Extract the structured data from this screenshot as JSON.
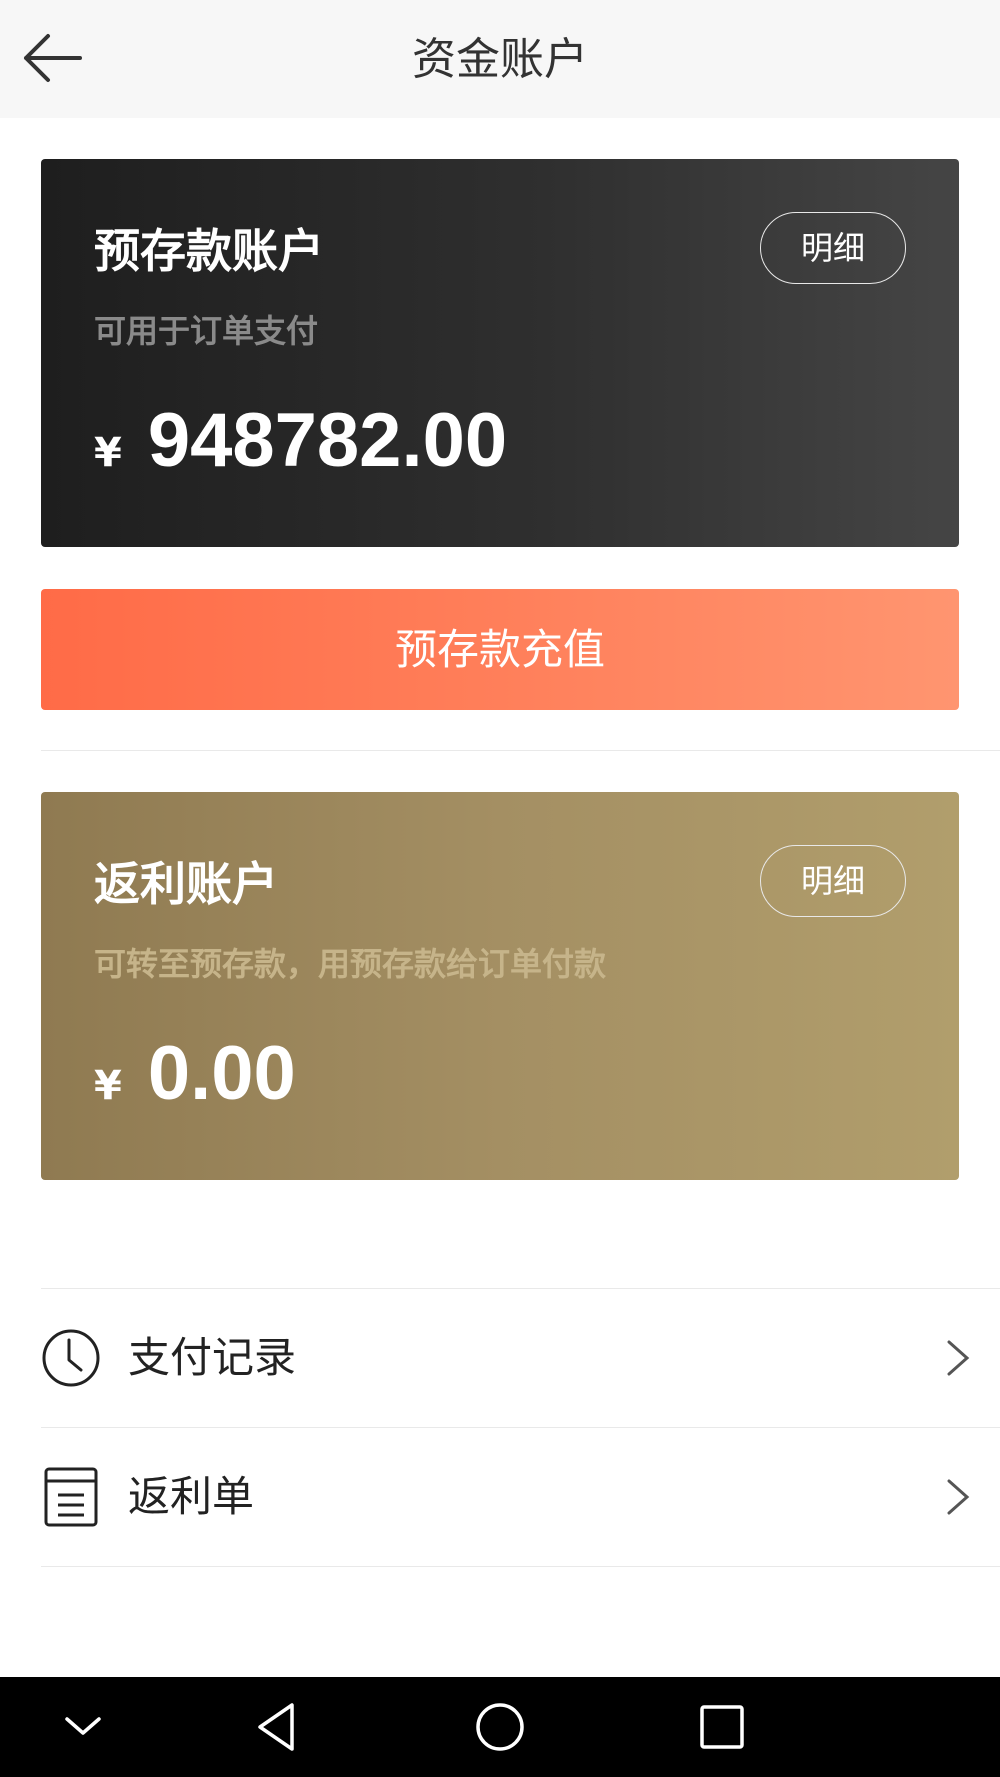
{
  "header": {
    "title": "资金账户",
    "back_icon": "arrow-left-icon"
  },
  "deposit_account": {
    "title": "预存款账户",
    "description": "可用于订单支付",
    "currency": "¥",
    "amount": "948782.00",
    "detail_label": "明细"
  },
  "recharge_button": {
    "label": "预存款充值"
  },
  "rebate_account": {
    "title": "返利账户",
    "description": "可转至预存款，用预存款给订单付款",
    "currency": "¥",
    "amount": "0.00",
    "detail_label": "明细"
  },
  "menu": [
    {
      "label": "支付记录",
      "icon": "clock-icon"
    },
    {
      "label": "返利单",
      "icon": "document-icon"
    }
  ],
  "navbar": {
    "keys": [
      "chevron-down-icon",
      "back-triangle-icon",
      "home-circle-icon",
      "recents-square-icon"
    ]
  },
  "colors": {
    "header_bg": "#f7f7f7",
    "deposit_card": "#2a2a2a",
    "rebate_card": "#a08c60",
    "recharge_button": "#ff7a55"
  }
}
